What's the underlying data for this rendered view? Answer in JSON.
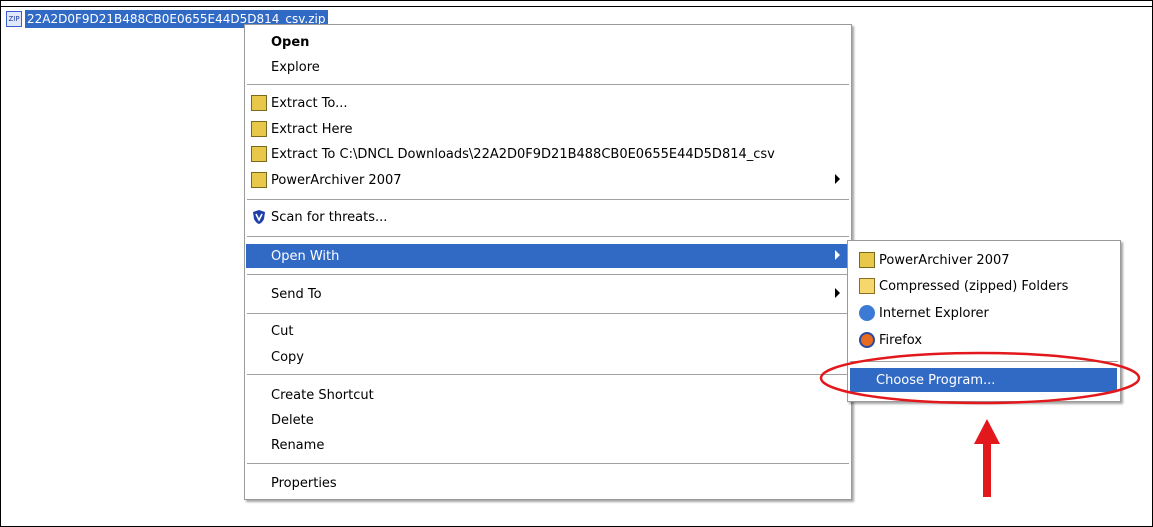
{
  "file": {
    "icon_label": "ZIP",
    "name": "22A2D0F9D21B488CB0E0655E44D5D814_csv.zip"
  },
  "context_menu": {
    "open": "Open",
    "explore": "Explore",
    "extract_to": "Extract To...",
    "extract_here": "Extract Here",
    "extract_to_path": "Extract To C:\\DNCL Downloads\\22A2D0F9D21B488CB0E0655E44D5D814_csv",
    "powerarchiver": "PowerArchiver 2007",
    "scan": "Scan for threats...",
    "open_with": "Open With",
    "send_to": "Send To",
    "cut": "Cut",
    "copy": "Copy",
    "create_shortcut": "Create Shortcut",
    "delete": "Delete",
    "rename": "Rename",
    "properties": "Properties"
  },
  "open_with_menu": {
    "items": [
      {
        "label": "PowerArchiver 2007",
        "icon": "archive-icon"
      },
      {
        "label": "Compressed (zipped) Folders",
        "icon": "zip-folder-icon"
      },
      {
        "label": "Internet Explorer",
        "icon": "internet-explorer-icon"
      },
      {
        "label": "Firefox",
        "icon": "firefox-icon"
      }
    ],
    "choose_program": "Choose Program..."
  },
  "colors": {
    "highlight": "#316ac5",
    "annotation": "#e3181c"
  }
}
